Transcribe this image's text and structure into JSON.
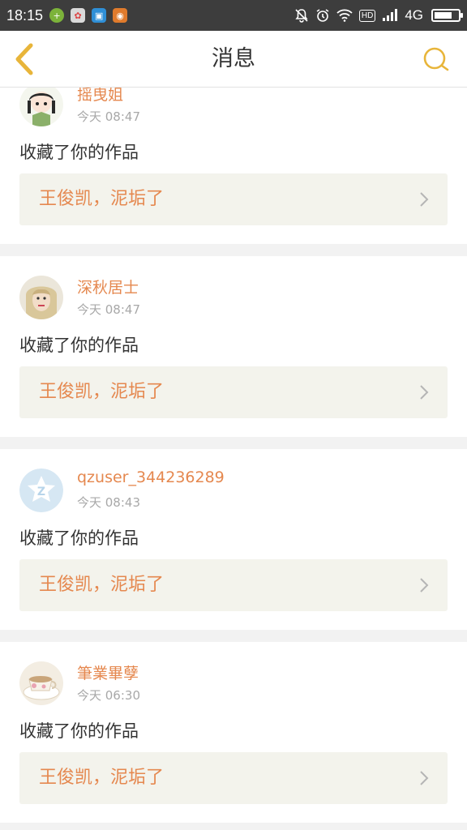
{
  "status_bar": {
    "time": "18:15",
    "network": "4G",
    "hd_label": "HD",
    "battery_level": 0.75,
    "apps": [
      "plus-app-icon",
      "photo-app-icon",
      "scan-app-icon",
      "camera-app-icon"
    ]
  },
  "nav": {
    "title": "消息",
    "back_icon": "chevron-left-icon",
    "search_icon": "search-icon",
    "accent": "#e8b53a"
  },
  "colors": {
    "accent_orange": "#e5884f",
    "nav_icon_yellow": "#e8b53a",
    "work_bg": "#f3f3ec"
  },
  "messages": [
    {
      "username": "摇曳姐",
      "time": "今天 08:47",
      "action": "收藏了你的作品",
      "work_title": "王俊凯，泥垢了",
      "avatar": "anime-girl-avatar"
    },
    {
      "username": "深秋居士",
      "time": "今天 08:47",
      "action": "收藏了你的作品",
      "work_title": "王俊凯，泥垢了",
      "avatar": "portrait-avatar"
    },
    {
      "username": "qzuser_344236289",
      "time": "今天 08:43",
      "action": "收藏了你的作品",
      "work_title": "王俊凯，泥垢了",
      "avatar": "qzone-default-avatar"
    },
    {
      "username": "筆業畢孽",
      "time": "今天 06:30",
      "action": "收藏了你的作品",
      "work_title": "王俊凯，泥垢了",
      "avatar": "teacup-avatar"
    }
  ]
}
